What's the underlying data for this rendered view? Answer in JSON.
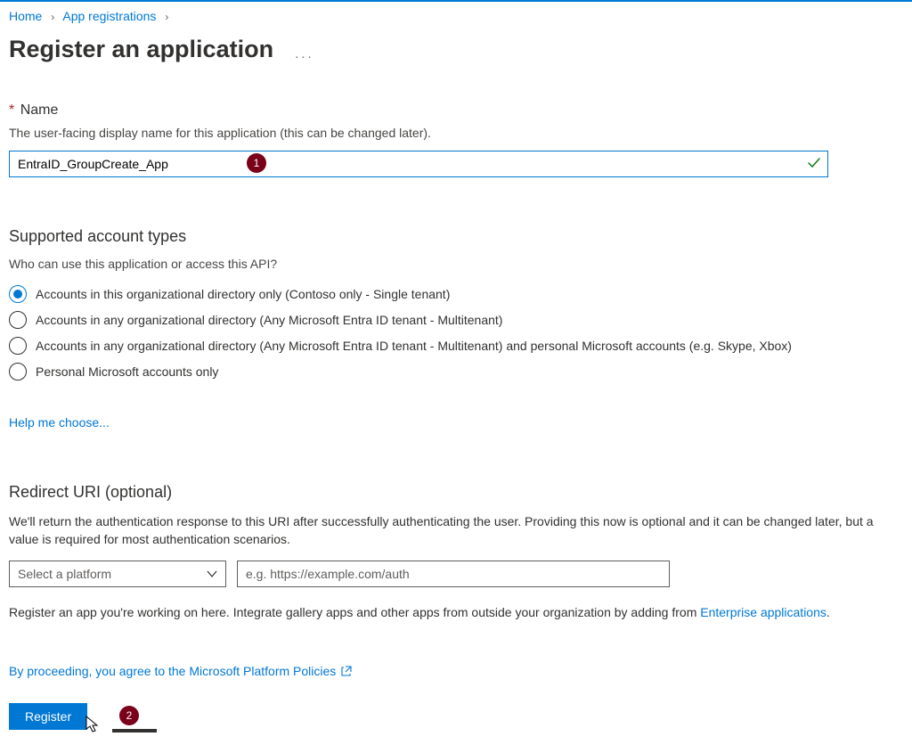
{
  "breadcrumb": {
    "home": "Home",
    "app_reg": "App registrations"
  },
  "page_title": "Register an application",
  "name_section": {
    "label": "Name",
    "helper": "The user-facing display name for this application (this can be changed later).",
    "value": "EntraID_GroupCreate_App"
  },
  "badge1": "1",
  "supported": {
    "heading": "Supported account types",
    "sub": "Who can use this application or access this API?",
    "options": [
      "Accounts in this organizational directory only (Contoso only - Single tenant)",
      "Accounts in any organizational directory (Any Microsoft Entra ID tenant - Multitenant)",
      "Accounts in any organizational directory (Any Microsoft Entra ID tenant - Multitenant) and personal Microsoft accounts (e.g. Skype, Xbox)",
      "Personal Microsoft accounts only"
    ],
    "help_link": "Help me choose..."
  },
  "redirect": {
    "heading": "Redirect URI (optional)",
    "desc": "We'll return the authentication response to this URI after successfully authenticating the user. Providing this now is optional and it can be changed later, but a value is required for most authentication scenarios.",
    "select_placeholder": "Select a platform",
    "uri_placeholder": "e.g. https://example.com/auth"
  },
  "bottom_note": {
    "pre": "Register an app you're working on here. Integrate gallery apps and other apps from outside your organization by adding from ",
    "link": "Enterprise applications",
    "post": "."
  },
  "policy": "By proceeding, you agree to the Microsoft Platform Policies",
  "register": "Register",
  "badge2": "2"
}
